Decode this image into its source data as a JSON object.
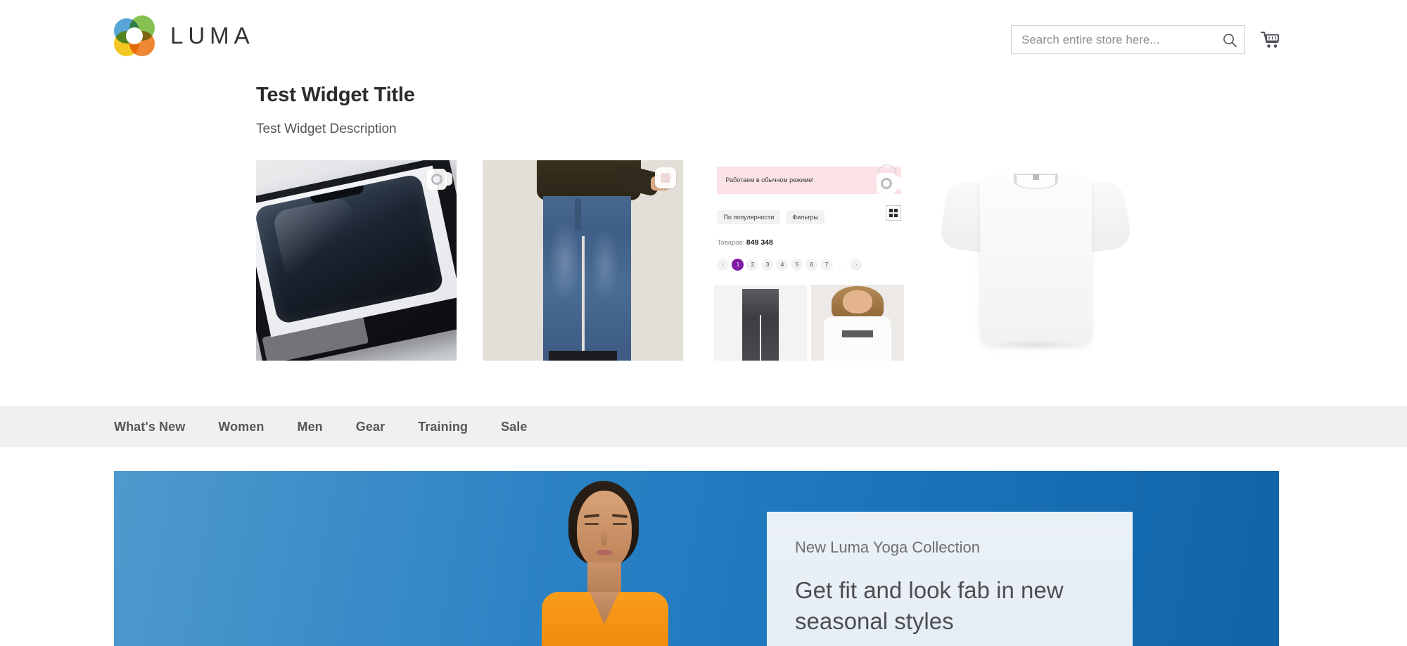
{
  "header": {
    "logo_text": "LUMA",
    "logo_icon": "luma-ring-logo",
    "search": {
      "placeholder": "Search entire store here...",
      "value": "",
      "icon": "search-icon"
    },
    "cart_icon": "shopping-cart-icon"
  },
  "widget": {
    "title": "Test Widget Title",
    "description": "Test Widget Description",
    "products": [
      {
        "name": "phone-in-box-photo",
        "watermark": "camera-watermark-icon"
      },
      {
        "name": "blue-jeans-model-photo",
        "watermark": "photo-watermark-icon"
      },
      {
        "name": "russian-shop-screenshot",
        "watermark": "camera-watermark-icon"
      },
      {
        "name": "white-tshirt-photo",
        "watermark": ""
      }
    ],
    "screenshot_product": {
      "banner": "Работаем в обычном режиме!",
      "chips": [
        "По популярности",
        "Фильтры"
      ],
      "grid_toggle_icon": "grid-view-icon",
      "count_label": "Товаров:",
      "count_value": "849 348",
      "pagination": {
        "prev": "‹",
        "pages": [
          "1",
          "2",
          "3",
          "4",
          "5",
          "6",
          "7"
        ],
        "active": "1",
        "ellipsis": "...",
        "next": "›"
      },
      "thumbs": [
        "gray-jeans-thumb",
        "mango-tshirt-model-thumb"
      ],
      "thumb_logo_text": "MANGO"
    }
  },
  "nav": {
    "items": [
      {
        "label": "What's New"
      },
      {
        "label": "Women"
      },
      {
        "label": "Men"
      },
      {
        "label": "Gear"
      },
      {
        "label": "Training"
      },
      {
        "label": "Sale"
      }
    ]
  },
  "hero": {
    "image_name": "woman-meditating-orange-shirt",
    "eyebrow": "New Luma Yoga Collection",
    "headline": "Get fit and look fab in new seasonal styles"
  },
  "colors": {
    "accent_blue": "#1b76bd",
    "nav_bg": "#f0f0f0",
    "pager_active": "#8019a8",
    "banner_pink": "#fbe2e6",
    "shirt_orange": "#fb9d1c"
  }
}
